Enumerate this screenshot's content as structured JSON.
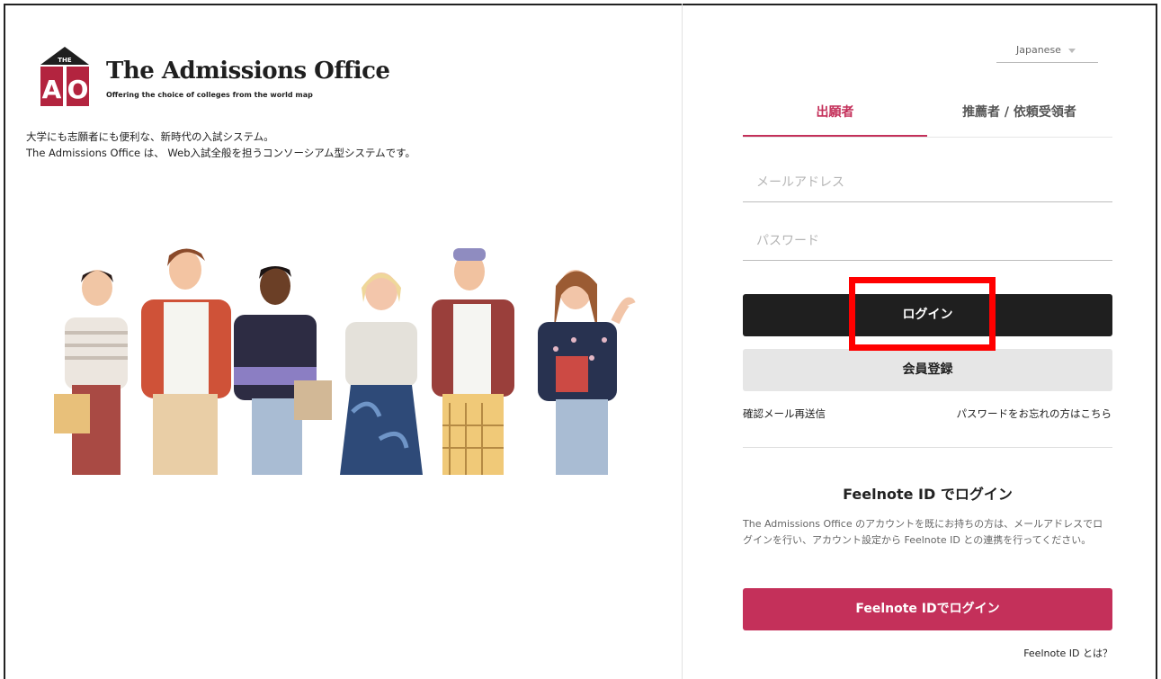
{
  "brand": {
    "logo_text_top": "THE",
    "logo_letters": "AO",
    "title": "The Admissions Office",
    "tagline": "Offering the choice of colleges from the world map"
  },
  "intro": {
    "line1": "大学にも志願者にも便利な、新時代の入試システム。",
    "line2": "The Admissions Office は、 Web入試全般を担うコンソーシアム型システムです。"
  },
  "language": {
    "selected": "Japanese"
  },
  "tabs": [
    {
      "label": "出願者",
      "active": true
    },
    {
      "label": "推薦者 / 依頼受領者",
      "active": false
    }
  ],
  "form": {
    "email_placeholder": "メールアドレス",
    "password_placeholder": "パスワード",
    "login_label": "ログイン",
    "register_label": "会員登録",
    "resend_link": "確認メール再送信",
    "forgot_link": "パスワードをお忘れの方はこちら"
  },
  "feelnote": {
    "title": "Feelnote ID でログイン",
    "description": "The Admissions Office のアカウントを既にお持ちの方は、メールアドレスでログインを行い、アカウント設定から Feelnote ID との連携を行ってください。",
    "button_label": "Feelnote IDでログイン",
    "what_link": "Feelnote ID とは？"
  },
  "colors": {
    "accent": "#c4305a",
    "logo_red": "#b3243f",
    "dark_button": "#1f1f1f",
    "highlight": "#ff0000"
  }
}
